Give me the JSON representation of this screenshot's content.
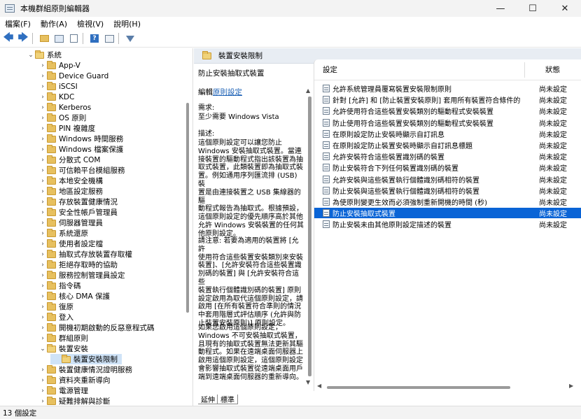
{
  "window": {
    "title": "本機群組原則編輯器",
    "minimize": "—",
    "maximize": "☐",
    "close": "✕"
  },
  "menu": [
    "檔案(F)",
    "動作(A)",
    "檢視(V)",
    "說明(H)"
  ],
  "tree": [
    {
      "label": "系統",
      "depth": 0,
      "expanded": true
    },
    {
      "label": "App-V",
      "depth": 1
    },
    {
      "label": "Device Guard",
      "depth": 1
    },
    {
      "label": "iSCSI",
      "depth": 1
    },
    {
      "label": "KDC",
      "depth": 1
    },
    {
      "label": "Kerberos",
      "depth": 1
    },
    {
      "label": "OS 原則",
      "depth": 1
    },
    {
      "label": "PIN 複雜度",
      "depth": 1
    },
    {
      "label": "Windows 時間服務",
      "depth": 1
    },
    {
      "label": "Windows 檔案保護",
      "depth": 1
    },
    {
      "label": "分散式 COM",
      "depth": 1
    },
    {
      "label": "可信賴平台模組服務",
      "depth": 1
    },
    {
      "label": "本地安全機構",
      "depth": 1
    },
    {
      "label": "地區設定服務",
      "depth": 1
    },
    {
      "label": "存放裝置健康情況",
      "depth": 1
    },
    {
      "label": "安全性帳戶管理員",
      "depth": 1
    },
    {
      "label": "伺服器管理員",
      "depth": 1
    },
    {
      "label": "系統還原",
      "depth": 1
    },
    {
      "label": "使用者設定檔",
      "depth": 1
    },
    {
      "label": "抽取式存放裝置存取權",
      "depth": 1
    },
    {
      "label": "拒絕存取時的協助",
      "depth": 1
    },
    {
      "label": "服務控制管理員設定",
      "depth": 1
    },
    {
      "label": "指令碼",
      "depth": 1
    },
    {
      "label": "核心 DMA 保護",
      "depth": 1
    },
    {
      "label": "復原",
      "depth": 1
    },
    {
      "label": "登入",
      "depth": 1
    },
    {
      "label": "開機初期啟動的反惡意程式碼",
      "depth": 1
    },
    {
      "label": "群組原則",
      "depth": 1
    },
    {
      "label": "裝置安裝",
      "depth": 1,
      "expanded": true
    },
    {
      "label": "裝置安裝限制",
      "depth": 2,
      "selected": true
    },
    {
      "label": "裝置健康情況證明服務",
      "depth": 1
    },
    {
      "label": "資料夾重新導向",
      "depth": 1
    },
    {
      "label": "電源管理",
      "depth": 1
    },
    {
      "label": "疑難排解與診斷",
      "depth": 1
    }
  ],
  "header": {
    "title": "裝置安裝限制"
  },
  "description": {
    "title": "防止安裝抽取式裝置",
    "edit_prefix": "編輯",
    "edit_link": "原則設定",
    "req_label": "需求:",
    "req_value": "至少需要 Windows Vista",
    "desc_label": "描述:",
    "desc_text": "這個原則設定可以讓您防止\nWindows 安裝抽取式裝置。當連\n接裝置的驅動程式指出該裝置為抽\n取式裝置，此類裝置即為抽取式裝\n置。例如通用序列匯流排 (USB) 裝\n置是由連接裝置之 USB 集線器的驅\n動程式報告為抽取式。根據預設，\n這個原則設定的優先順序高於其他\n允許 Windows 安裝裝置的任何其\n他原則設定。",
    "note_text": "請注意: 若要為適用的裝置將 [允許\n使用符合這些裝置安裝類別來安裝\n裝置]、[允許安裝符合這些裝置識\n別碼的裝置] 與 [允許安裝符合這些\n裝置執行個體識別碼的裝置] 原則\n設定啟用為取代這個原則設定，請\n啟用 [在所有裝置符合準則的情況\n中套用階層式評估順序 (允許與防\n止裝置安裝原則)] 原則設定。",
    "enable_text": "如果您啟用這個原則設定，\nWindows 不可安裝抽取式裝置，\n且現有的抽取式裝置無法更新其驅\n動程式。如果在遠端桌面伺服器上\n啟用這個原則設定，這個原則設定\n會影響抽取式裝置從遠端桌面用戶\n端到遠端桌面伺服器的重新導向。"
  },
  "list": {
    "col_setting": "設定",
    "col_state": "狀態",
    "rows": [
      {
        "name": "允許系統管理員覆寫裝置安裝限制原則",
        "state": "尚未設定"
      },
      {
        "name": "針對 [允許] 和 [防止裝置安裝原則] 套用所有裝置符合條件的...",
        "state": "尚未設定"
      },
      {
        "name": "允許使用符合這些裝置安裝類別的驅動程式安裝裝置",
        "state": "尚未設定"
      },
      {
        "name": "防止使用符合這些裝置安裝類別的驅動程式安裝裝置",
        "state": "尚未設定"
      },
      {
        "name": "在原則設定防止安裝時顯示自訂訊息",
        "state": "尚未設定"
      },
      {
        "name": "在原則設定防止裝置安裝時顯示自訂訊息標題",
        "state": "尚未設定"
      },
      {
        "name": "允許安裝符合這些裝置識別碼的裝置",
        "state": "尚未設定"
      },
      {
        "name": "防止安裝符合下列任何裝置識別碼的裝置",
        "state": "尚未設定"
      },
      {
        "name": "允許安裝與這些裝置執行個體識別碼相符的裝置",
        "state": "尚未設定"
      },
      {
        "name": "防止安裝與這些裝置執行個體識別碼相符的裝置",
        "state": "尚未設定"
      },
      {
        "name": "為使原則變更生效而必須強制重新開機的時間 (秒)",
        "state": "尚未設定"
      },
      {
        "name": "防止安裝抽取式裝置",
        "state": "尚未設定",
        "selected": true
      },
      {
        "name": "防止安裝未由其他原則設定描述的裝置",
        "state": "尚未設定"
      }
    ]
  },
  "tabs": [
    "延伸",
    "標準"
  ],
  "status": {
    "text": "13 個設定"
  }
}
